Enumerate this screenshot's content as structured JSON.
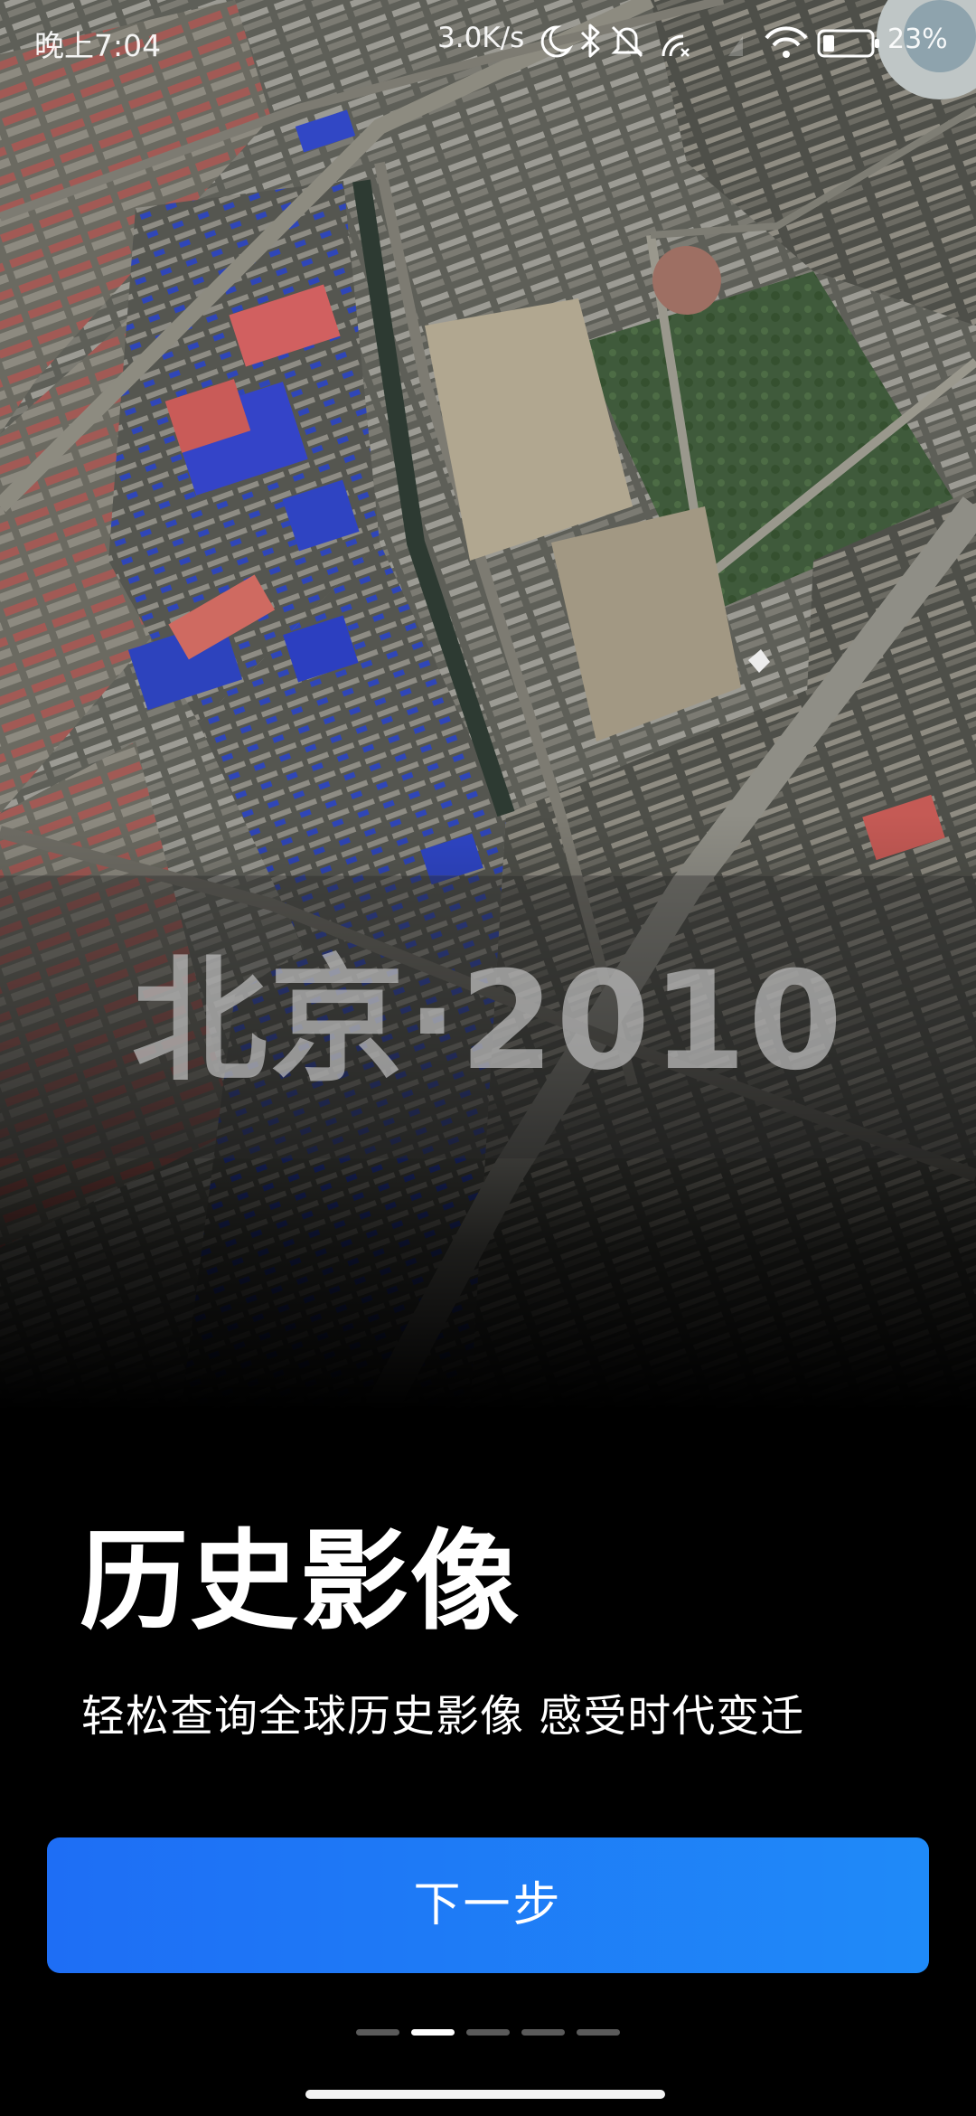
{
  "status_bar": {
    "time": "晚上7:04",
    "network_speed": "3.0K/s",
    "battery_percent": "23%",
    "icons": [
      "moon-icon",
      "bluetooth-icon",
      "mute-bell-icon",
      "no-signal-icon",
      "wifi-icon",
      "battery-icon"
    ]
  },
  "banner": {
    "year_label": "北京·2010"
  },
  "content": {
    "title": "历史影像",
    "subtitle": "轻松查询全球历史影像 感受时代变迁"
  },
  "actions": {
    "next_label": "下一步"
  },
  "pagination": {
    "total": 5,
    "current": 2
  },
  "colors": {
    "accent": "#1f7ff6",
    "background": "#000000"
  }
}
